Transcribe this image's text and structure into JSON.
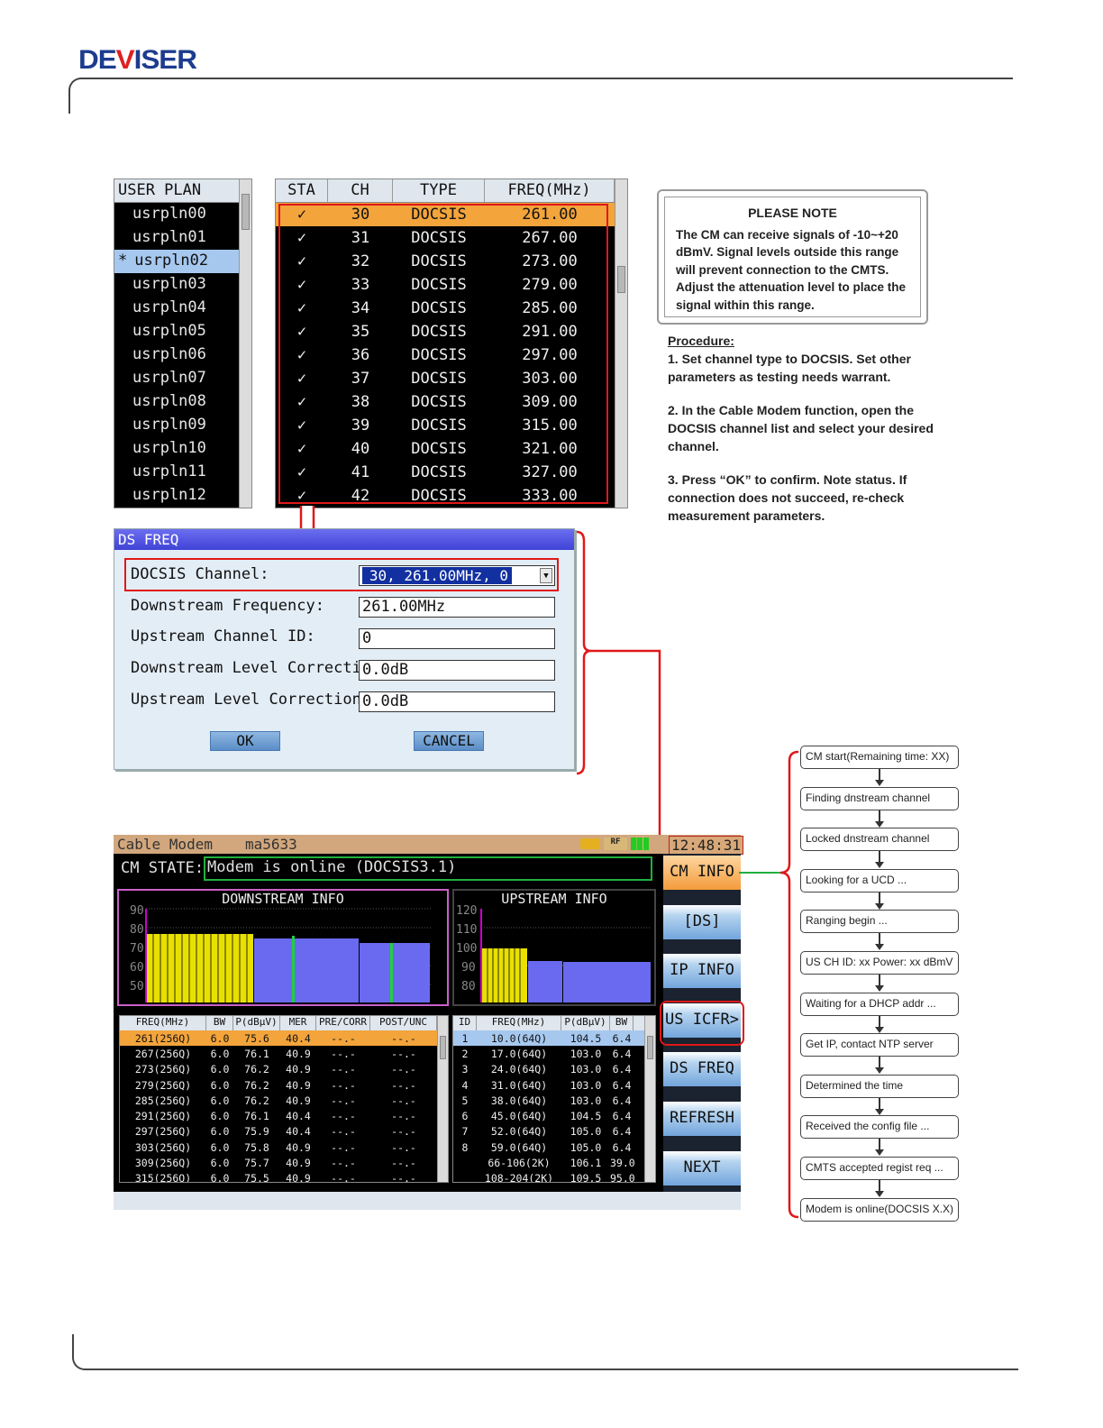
{
  "brand": {
    "logo": "DEVISER"
  },
  "user_plan": {
    "header": "USER PLAN",
    "items": [
      "usrpln00",
      "usrpln01",
      "usrpln02",
      "usrpln03",
      "usrpln04",
      "usrpln05",
      "usrpln06",
      "usrpln07",
      "usrpln08",
      "usrpln09",
      "usrpln10",
      "usrpln11",
      "usrpln12"
    ],
    "selected_marker": "*"
  },
  "channel_table": {
    "headers": [
      "STA",
      "CH",
      "TYPE",
      "FREQ(MHz)"
    ],
    "check": "✓",
    "rows": [
      [
        "30",
        "DOCSIS",
        "261.00"
      ],
      [
        "31",
        "DOCSIS",
        "267.00"
      ],
      [
        "32",
        "DOCSIS",
        "273.00"
      ],
      [
        "33",
        "DOCSIS",
        "279.00"
      ],
      [
        "34",
        "DOCSIS",
        "285.00"
      ],
      [
        "35",
        "DOCSIS",
        "291.00"
      ],
      [
        "36",
        "DOCSIS",
        "297.00"
      ],
      [
        "37",
        "DOCSIS",
        "303.00"
      ],
      [
        "38",
        "DOCSIS",
        "309.00"
      ],
      [
        "39",
        "DOCSIS",
        "315.00"
      ],
      [
        "40",
        "DOCSIS",
        "321.00"
      ],
      [
        "41",
        "DOCSIS",
        "327.00"
      ],
      [
        "42",
        "DOCSIS",
        "333.00"
      ]
    ]
  },
  "note": {
    "title": "PLEASE NOTE",
    "body": "The CM can receive signals of -10~+20 dBmV. Signal levels outside this range will prevent connection to the CMTS. Adjust the attenuation level to place the signal within this range."
  },
  "procedure": {
    "title": "Procedure:",
    "steps": [
      "1. Set channel type to DOCSIS. Set other parameters as testing needs warrant.",
      "2. In the Cable Modem function, open the DOCSIS channel list and select your desired channel.",
      "3. Press “OK” to confirm. Note status. If connection does not succeed, re-check measurement parameters."
    ]
  },
  "dialog": {
    "title": "DS FREQ",
    "docsis_label": "DOCSIS Channel:",
    "docsis_value": "30, 261.00MHz, 0",
    "ds_freq_label": "Downstream Frequency:",
    "ds_freq_value": "261.00MHz",
    "us_id_label": "Upstream Channel ID:",
    "us_id_value": "0",
    "ds_corr_label": "Downstream Level Correction:",
    "ds_corr_value": "0.0dB",
    "us_corr_label": "Upstream Level Correction:",
    "us_corr_value": "0.0dB",
    "ok": "OK",
    "cancel": "CANCEL"
  },
  "cable_modem": {
    "title": "Cable Modem",
    "device": "ma5633",
    "rf": "RF",
    "time": "12:48:31",
    "state_label": "CM STATE:",
    "state_value": "Modem is online (DOCSIS3.1)",
    "downstream": {
      "title": "DOWNSTREAM INFO",
      "yticks": [
        "90",
        "80",
        "70",
        "60",
        "50"
      ]
    },
    "upstream": {
      "title": "UPSTREAM INFO",
      "yticks": [
        "120",
        "110",
        "100",
        "90",
        "80"
      ]
    },
    "buttons": [
      "CM INFO",
      "[DS]",
      "IP INFO",
      "US ICFR>",
      "DS FREQ",
      "REFRESH",
      "NEXT"
    ],
    "ds_table": {
      "headers": [
        "FREQ(MHz)",
        "BW",
        "P(dBμV)",
        "MER",
        "PRE/CORR",
        "POST/UNC"
      ],
      "rows": [
        [
          "261(256Q)",
          "6.0",
          "75.6",
          "40.4",
          "--.-",
          "--.-"
        ],
        [
          "267(256Q)",
          "6.0",
          "76.1",
          "40.9",
          "--.-",
          "--.-"
        ],
        [
          "273(256Q)",
          "6.0",
          "76.2",
          "40.9",
          "--.-",
          "--.-"
        ],
        [
          "279(256Q)",
          "6.0",
          "76.2",
          "40.9",
          "--.-",
          "--.-"
        ],
        [
          "285(256Q)",
          "6.0",
          "76.2",
          "40.9",
          "--.-",
          "--.-"
        ],
        [
          "291(256Q)",
          "6.0",
          "76.1",
          "40.4",
          "--.-",
          "--.-"
        ],
        [
          "297(256Q)",
          "6.0",
          "75.9",
          "40.4",
          "--.-",
          "--.-"
        ],
        [
          "303(256Q)",
          "6.0",
          "75.8",
          "40.9",
          "--.-",
          "--.-"
        ],
        [
          "309(256Q)",
          "6.0",
          "75.7",
          "40.9",
          "--.-",
          "--.-"
        ],
        [
          "315(256Q)",
          "6.0",
          "75.5",
          "40.9",
          "--.-",
          "--.-"
        ]
      ]
    },
    "us_table": {
      "headers": [
        "ID",
        "FREQ(MHz)",
        "P(dBμV)",
        "BW"
      ],
      "rows": [
        [
          "1",
          "10.0(64Q)",
          "104.5",
          "6.4"
        ],
        [
          "2",
          "17.0(64Q)",
          "103.0",
          "6.4"
        ],
        [
          "3",
          "24.0(64Q)",
          "103.0",
          "6.4"
        ],
        [
          "4",
          "31.0(64Q)",
          "103.0",
          "6.4"
        ],
        [
          "5",
          "38.0(64Q)",
          "103.0",
          "6.4"
        ],
        [
          "6",
          "45.0(64Q)",
          "104.5",
          "6.4"
        ],
        [
          "7",
          "52.0(64Q)",
          "105.0",
          "6.4"
        ],
        [
          "8",
          "59.0(64Q)",
          "105.0",
          "6.4"
        ],
        [
          "",
          "66-106(2K)",
          "106.1",
          "39.0"
        ],
        [
          "",
          "108-204(2K)",
          "109.5",
          "95.0"
        ]
      ]
    }
  },
  "flow": [
    "CM start(Remaining time: XX)",
    "Finding dnstream channel",
    "Locked dnstream channel",
    "Looking for a UCD ...",
    "Ranging begin ...",
    "US CH ID: xx  Power: xx dBmV",
    "Waiting for a DHCP addr ...",
    "Get IP, contact NTP server",
    "Determined the time",
    "Received the config file ...",
    "CMTS accepted regist req ...",
    "Modem is online(DOCSIS X.X)"
  ],
  "colors": {
    "highlight_red": "#e01818",
    "highlight_green": "#20b040",
    "selected_orange": "#f3a43b",
    "ds_bar_yellow": "#e8e000",
    "bar_blue": "#6a6af0"
  }
}
